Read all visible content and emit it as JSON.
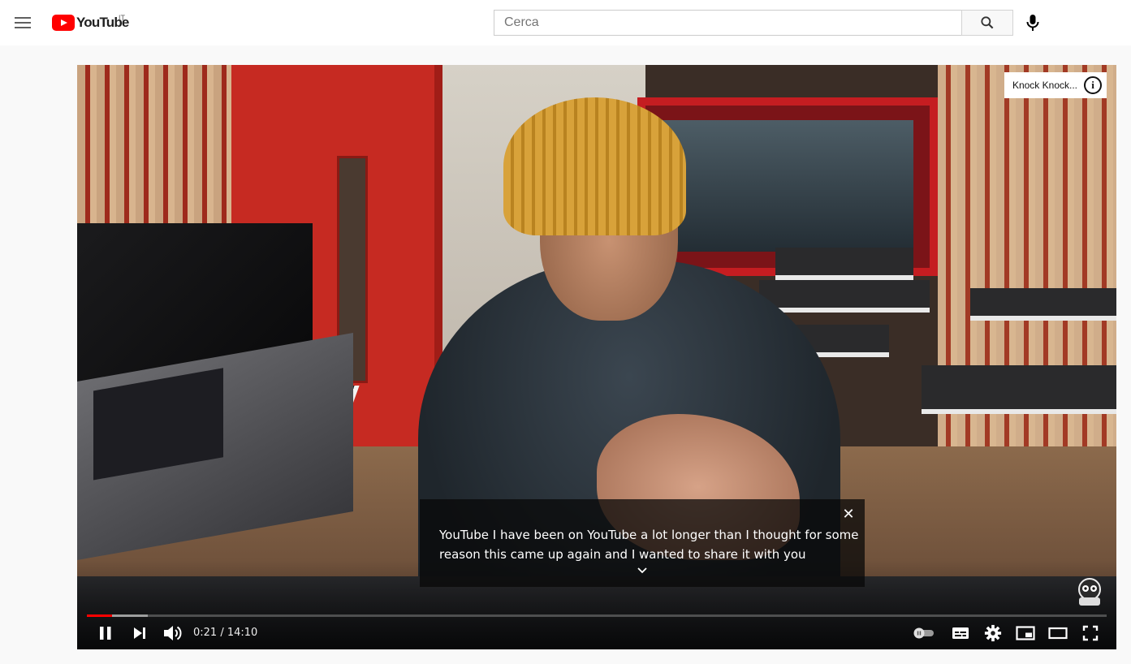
{
  "masthead": {
    "logo_text": "YouTube",
    "country_code": "IT",
    "search_placeholder": "Cerca"
  },
  "player": {
    "card_teaser": "Knock Knock...",
    "card_icon": "i",
    "caption": {
      "lines": [
        "YouTube I have been on YouTube a lot longer than I thought for some",
        "reason this came up again and I wanted to share it with you"
      ],
      "close_label": "✕"
    },
    "time": {
      "current": "0:21",
      "separator": " / ",
      "duration": "14:10"
    },
    "progress": {
      "played_fraction": 0.025,
      "loaded_fraction": 0.06
    },
    "icons": [
      "pause-icon",
      "next-icon",
      "volume-icon",
      "autoplay-toggle-icon",
      "subtitles-icon",
      "settings-icon",
      "miniplayer-icon",
      "theater-mode-icon",
      "fullscreen-icon"
    ]
  },
  "colors": {
    "brand_red": "#FF0000",
    "progress_red": "#FF0000"
  }
}
